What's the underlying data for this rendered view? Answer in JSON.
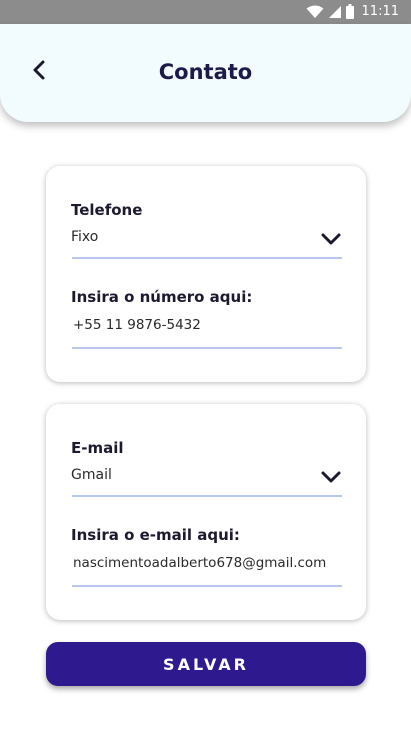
{
  "status_bar": {
    "time": "11:11"
  },
  "header": {
    "title": "Contato"
  },
  "phone_card": {
    "type_label": "Telefone",
    "type_value": "Fixo",
    "number_label": "Insira o número aqui:",
    "number_value": "+55 11 9876-5432"
  },
  "email_card": {
    "type_label": "E-mail",
    "type_value": "Gmail",
    "address_label": "Insira o e-mail aqui:",
    "address_value": "nascimentoadalberto678@gmail.com"
  },
  "actions": {
    "save_label": "SALVAR"
  },
  "colors": {
    "primary": "#2e1a8e",
    "title": "#1c1a4a",
    "underline": "#b7c7ee",
    "header_bg": "#f2fcfe",
    "status_bar": "#8c8c8c"
  }
}
